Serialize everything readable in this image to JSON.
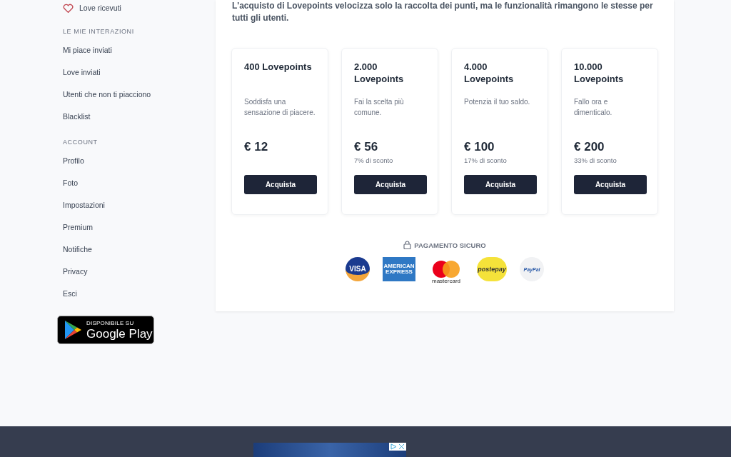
{
  "sidebar": {
    "sections": [
      {
        "items": [
          {
            "label": "Love ricevuti",
            "kind": "heart"
          }
        ]
      },
      {
        "heading": "LE MIE INTERAZIONI",
        "items": [
          {
            "label": "Mi piace inviati",
            "kind": "plain"
          },
          {
            "label": "Love inviati",
            "kind": "plain"
          },
          {
            "label": "Utenti che non ti piacciono",
            "kind": "plain"
          },
          {
            "label": "Blacklist",
            "kind": "plain"
          }
        ]
      },
      {
        "heading": "ACCOUNT",
        "items": [
          {
            "label": "Profilo",
            "kind": "plain"
          },
          {
            "label": "Foto",
            "kind": "plain"
          },
          {
            "label": "Impostazioni",
            "kind": "plain"
          },
          {
            "label": "Premium",
            "kind": "plain"
          },
          {
            "label": "Notifiche",
            "kind": "plain"
          },
          {
            "label": "Privacy",
            "kind": "plain"
          },
          {
            "label": "Esci",
            "kind": "plain"
          }
        ]
      }
    ],
    "store_badge": {
      "caption": "DISPONIBILE SU",
      "store": "Google Play"
    }
  },
  "main": {
    "intro": "L'acquisto di Lovepoints velocizza solo la raccolta dei punti, ma le funzionalità rimangono le stesse per tutti gli utenti.",
    "packages": [
      {
        "title": "400 Lovepoints",
        "description": "Soddisfa una sensazione di piacere.",
        "price": "€ 12",
        "button": "Acquista"
      },
      {
        "title": "2.000 Lovepoints",
        "description": "Fai la scelta più comune.",
        "price": "€ 56",
        "discount": "7% di sconto",
        "button": "Acquista"
      },
      {
        "title": "4.000 Lovepoints",
        "description": "Potenzia il tuo saldo.",
        "price": "€ 100",
        "discount": "17% di sconto",
        "button": "Acquista"
      },
      {
        "title": "10.000 Lovepoints",
        "description": "Fallo ora e dimenticalo.",
        "price": "€ 200",
        "discount": "33% di sconto",
        "button": "Acquista"
      }
    ],
    "secure_payment": {
      "label": "PAGAMENTO SICURO",
      "methods": [
        {
          "kind": "visa",
          "label": "VISA"
        },
        {
          "kind": "amex",
          "label": "AMERICAN EXPRESS"
        },
        {
          "kind": "mastercard",
          "label": "mastercard"
        },
        {
          "kind": "postepay",
          "label": "postepay"
        },
        {
          "kind": "paypal",
          "label": "PayPal"
        }
      ]
    }
  }
}
